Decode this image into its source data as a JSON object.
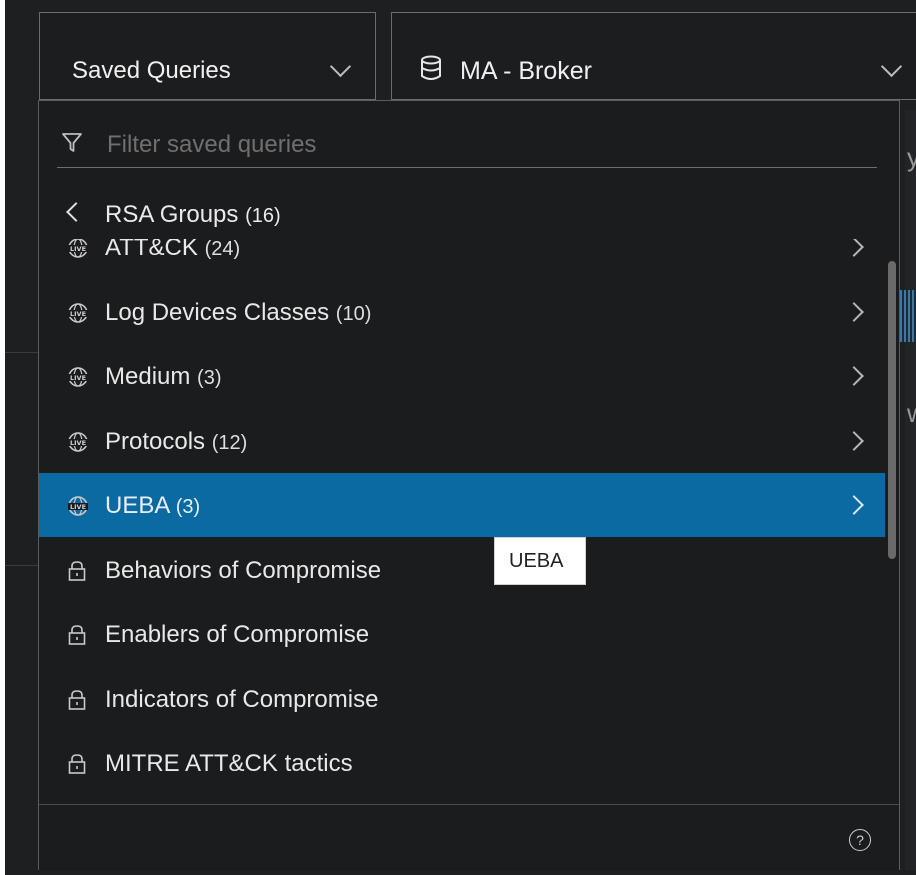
{
  "header": {
    "saved_queries_label": "Saved Queries",
    "service_label": "MA - Broker"
  },
  "filter": {
    "placeholder": "Filter saved queries",
    "value": ""
  },
  "group": {
    "title": "RSA Groups",
    "count": "(16)"
  },
  "list": {
    "items": [
      {
        "label": "ATT&CK",
        "count": "(24)",
        "icon": "live-icon",
        "has_arrow": true
      },
      {
        "label": "Log Devices Classes",
        "count": "(10)",
        "icon": "live-icon",
        "has_arrow": true
      },
      {
        "label": "Medium",
        "count": "(3)",
        "icon": "live-icon",
        "has_arrow": true
      },
      {
        "label": "Protocols",
        "count": "(12)",
        "icon": "live-icon",
        "has_arrow": true
      },
      {
        "label": "UEBA",
        "count": "(3)",
        "icon": "live-icon",
        "has_arrow": true,
        "selected": true
      },
      {
        "label": "Behaviors of Compromise",
        "count": "",
        "icon": "lock-icon",
        "has_arrow": false
      },
      {
        "label": "Enablers of Compromise",
        "count": "",
        "icon": "lock-icon",
        "has_arrow": false
      },
      {
        "label": "Indicators of Compromise",
        "count": "",
        "icon": "lock-icon",
        "has_arrow": false
      },
      {
        "label": "MITRE ATT&CK tactics",
        "count": "",
        "icon": "lock-icon",
        "has_arrow": false
      }
    ]
  },
  "tooltip": {
    "text": "UEBA"
  },
  "colors": {
    "selected_row": "#0b6aa2",
    "panel_bg": "#1b1c1e"
  }
}
